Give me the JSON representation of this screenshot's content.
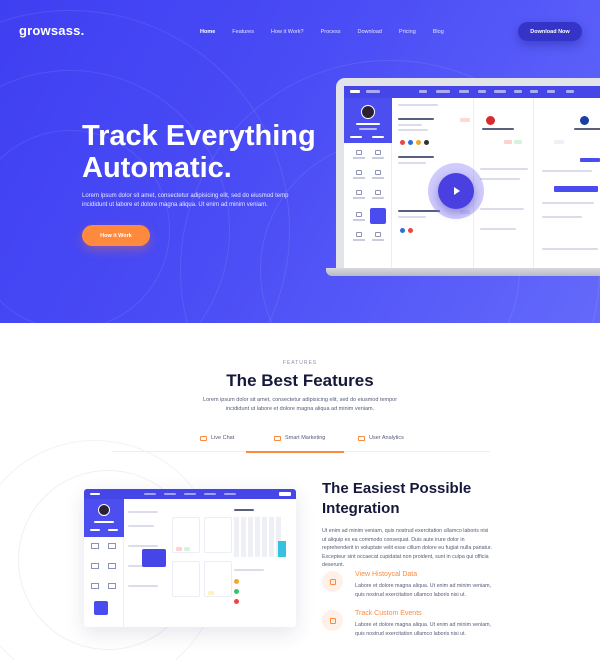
{
  "brand": {
    "logo": "growsass."
  },
  "nav": {
    "links": [
      "Home",
      "Features",
      "How it Work?",
      "Process",
      "Download",
      "Pricing",
      "Blog"
    ],
    "active": "Home",
    "cta_label": "Download Now"
  },
  "hero": {
    "title_line1": "Track Everything",
    "title_line2": "Automatic.",
    "description": "Lorem ipsum dolor sit amet, consectetur adipisicing elit, sed do eiusmod temp incididunt ut labore et dolore magna aliqua. Ut enim ad minim veniam.",
    "cta_label": "How it Work"
  },
  "features": {
    "kicker": "FEATURES",
    "title": "The Best Features",
    "description": "Lorem ipsum dolor sit amet, consectetur adipisicing elit, sed do eiusmod tempor incididunt ut labore et dolore magna aliqua ad minim veniam.",
    "tabs": [
      {
        "label": "Live Chat",
        "icon": "chat-icon"
      },
      {
        "label": "Smart Marketing",
        "icon": "mail-icon"
      },
      {
        "label": "User Analytics",
        "icon": "chart-icon"
      }
    ],
    "active_tab": "Smart Marketing"
  },
  "integration": {
    "title": "The Easiest Possible Integration",
    "description": "Ut enim ad minim veniam, quis nostrud exercitation ullamco laboris nisi ut aliquip ex ea commodo consequat. Duis aute irure dolor in reprehenderit in voluptate velit esse cillum dolore eu fugiat nulla pariatur. Excepteur sint occaecat cupidatat non proident, sunt in culpa qui officia deserunt.",
    "items": [
      {
        "title": "View Histoycal Data",
        "text": "Labore et dolore magna aliqua. Ut enim ad minim veniam, quis nostrud exercitation ullamco laboris nisi ut.",
        "icon": "history-icon"
      },
      {
        "title": "Track Custom Events",
        "text": "Labore et dolore magna aliqua. Ut enim ad minim veniam, quis nostrud exercitation ullamco laboris nisi ut.",
        "icon": "events-icon"
      }
    ]
  },
  "colors": {
    "primary": "#4646e8",
    "accent": "#ff8a3d",
    "heading": "#15183a"
  }
}
